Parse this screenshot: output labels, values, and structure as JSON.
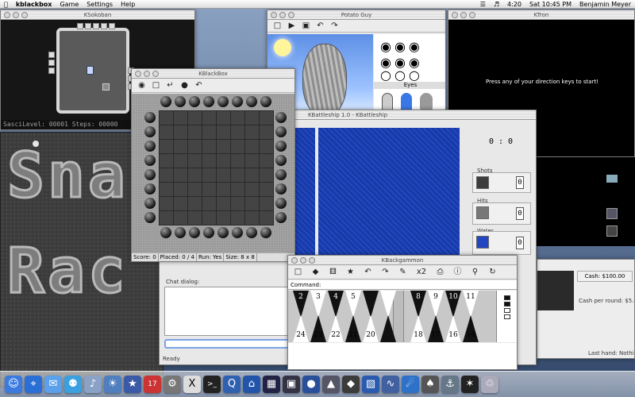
{
  "menubar": {
    "app_name": "kblackbox",
    "menus": [
      "Game",
      "Settings",
      "Help"
    ],
    "clock": "4:20",
    "date_time": "Sat 10:45 PM",
    "user": "Benjamin Meyer"
  },
  "ksokoban": {
    "title": "KSokoban",
    "status": "SasciLevel: 00001 Steps: 00000"
  },
  "ksnake": {
    "text_top": "Sna",
    "text_bottom": "Rac"
  },
  "kblackbox": {
    "title": "KBlackBox",
    "status": {
      "score": "Score: 0",
      "placed": "Placed: 0 / 4",
      "run": "Run: Yes",
      "size": "Size: 8 x 8"
    }
  },
  "potato": {
    "title": "Potato Guy",
    "section_label": "Eyes"
  },
  "ktron": {
    "title": "KTron",
    "message": "Press any of your direction keys to start!"
  },
  "kbattleship": {
    "title": "KBattleship 1.0 - KBattleship",
    "score": "0 : 0",
    "shots_label": "Shots",
    "shots_value": "0",
    "hits_label": "Hits",
    "hits_value": "0",
    "water_label": "Water",
    "water_value": "0",
    "chat_label": "Chat dialog:",
    "ready": "Ready"
  },
  "kbackgammon": {
    "title": "KBackgammon",
    "command_label": "Command:",
    "cube": "x2",
    "top_points": [
      "2",
      "3",
      "4",
      "5",
      "",
      "",
      "8",
      "9",
      "10",
      "11"
    ],
    "bottom_points": [
      "24",
      "23",
      "22",
      "21",
      "20",
      "",
      "18",
      "17",
      "16",
      "14"
    ]
  },
  "slot": {
    "cash": "Cash: $100.00",
    "cash_per_round": "Cash per round: $5.00",
    "last_hand": "Last hand: Nothi"
  },
  "dock_icons": [
    "finder-icon",
    "safari-icon",
    "mail-icon",
    "ichat-icon",
    "itunes-icon",
    "iphoto-icon",
    "imovie-icon",
    "ical-icon",
    "preferences-icon",
    "x11-icon",
    "terminal-icon",
    "quicktime-icon",
    "kde-icon",
    "kblackbox-icon",
    "ksokoban-icon",
    "klines-icon",
    "kbackgammon-icon",
    "kmines-icon",
    "ktron-icon",
    "ksnake-icon",
    "kbounce-icon",
    "kpoker-icon",
    "kbattleship-icon",
    "kasteroids-icon",
    "trash-icon"
  ]
}
